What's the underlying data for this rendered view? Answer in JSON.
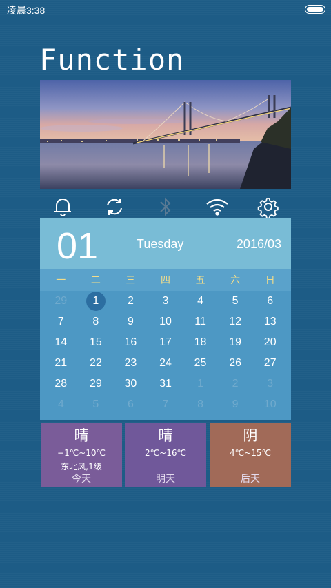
{
  "status_bar": {
    "time": "凌晨3:38"
  },
  "app": {
    "title": "Function"
  },
  "quick_icons": [
    "bell-icon",
    "sync-icon",
    "bluetooth-icon",
    "wifi-icon",
    "gear-icon"
  ],
  "calendar": {
    "day": "01",
    "weekday": "Tuesday",
    "month": "2016/03",
    "week_headers": [
      "一",
      "二",
      "三",
      "四",
      "五",
      "六",
      "日"
    ],
    "cells": [
      {
        "d": "29",
        "m": true
      },
      {
        "d": "1",
        "today": true
      },
      {
        "d": "2"
      },
      {
        "d": "3"
      },
      {
        "d": "4"
      },
      {
        "d": "5"
      },
      {
        "d": "6"
      },
      {
        "d": "7"
      },
      {
        "d": "8"
      },
      {
        "d": "9"
      },
      {
        "d": "10"
      },
      {
        "d": "11"
      },
      {
        "d": "12"
      },
      {
        "d": "13"
      },
      {
        "d": "14"
      },
      {
        "d": "15"
      },
      {
        "d": "16"
      },
      {
        "d": "17"
      },
      {
        "d": "18"
      },
      {
        "d": "19"
      },
      {
        "d": "20"
      },
      {
        "d": "21"
      },
      {
        "d": "22"
      },
      {
        "d": "23"
      },
      {
        "d": "24"
      },
      {
        "d": "25"
      },
      {
        "d": "26"
      },
      {
        "d": "27"
      },
      {
        "d": "28"
      },
      {
        "d": "29"
      },
      {
        "d": "30"
      },
      {
        "d": "31"
      },
      {
        "d": "1",
        "m": true
      },
      {
        "d": "2",
        "m": true
      },
      {
        "d": "3",
        "m": true
      },
      {
        "d": "4",
        "m": true
      },
      {
        "d": "5",
        "m": true
      },
      {
        "d": "6",
        "m": true
      },
      {
        "d": "7",
        "m": true
      },
      {
        "d": "8",
        "m": true
      },
      {
        "d": "9",
        "m": true
      },
      {
        "d": "10",
        "m": true
      }
    ]
  },
  "weather": [
    {
      "condition": "晴",
      "temp": "−1℃~10℃",
      "wind": "东北风,1级",
      "day": "今天"
    },
    {
      "condition": "晴",
      "temp": "2℃~16℃",
      "wind": "",
      "day": "明天"
    },
    {
      "condition": "阴",
      "temp": "4℃~15℃",
      "wind": "",
      "day": "后天"
    }
  ],
  "colors": {
    "background": "#1d5c86",
    "calendar_header": "#79bcd6",
    "calendar_body": "#4d98c4",
    "weekday_header_text": "#f3dd8a",
    "today_weather": "#7a5c99",
    "tomorrow_weather": "#70589a",
    "after_tomorrow_weather": "#a16a58"
  }
}
